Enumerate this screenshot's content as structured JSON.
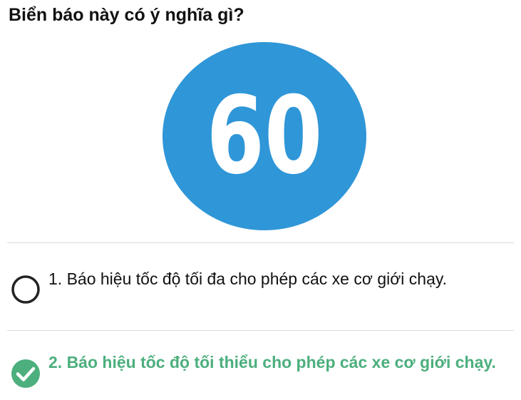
{
  "question": {
    "title": "Biển báo này có ý nghĩa gì?"
  },
  "sign": {
    "number": "60",
    "background_color": "#2f96d8",
    "text_color": "#ffffff",
    "shape": "circle"
  },
  "options": [
    {
      "label": "1. Báo hiệu tốc độ tối đa cho phép các xe cơ giới chạy.",
      "selected": false,
      "correct": false,
      "icon": "empty-radio-icon"
    },
    {
      "label": "2. Báo hiệu tốc độ tối thiểu cho phép các xe cơ giới chạy.",
      "selected": true,
      "correct": true,
      "icon": "check-circle-icon",
      "color": "#4caf7d"
    }
  ]
}
